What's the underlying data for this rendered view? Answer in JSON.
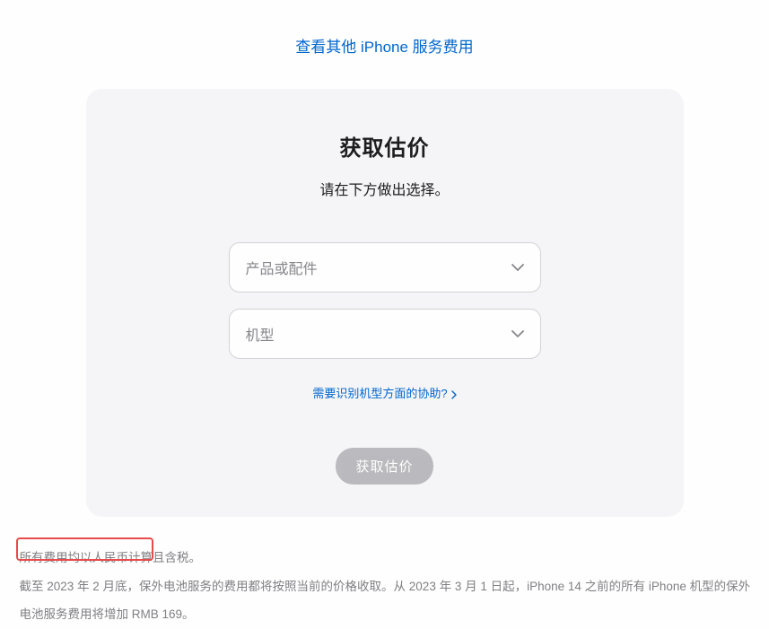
{
  "top_link": "查看其他 iPhone 服务费用",
  "card": {
    "title": "获取估价",
    "subtitle": "请在下方做出选择。",
    "select_product_placeholder": "产品或配件",
    "select_model_placeholder": "机型",
    "help_link": "需要识别机型方面的协助?",
    "submit_label": "获取估价"
  },
  "footnotes": {
    "line1": "所有费用均以人民币计算且含税。",
    "line2": "截至 2023 年 2 月底，保外电池服务的费用都将按照当前的价格收取。从 2023 年 3 月 1 日起，iPhone 14 之前的所有 iPhone 机型的保外电池服务费用将增加 RMB 169。"
  }
}
